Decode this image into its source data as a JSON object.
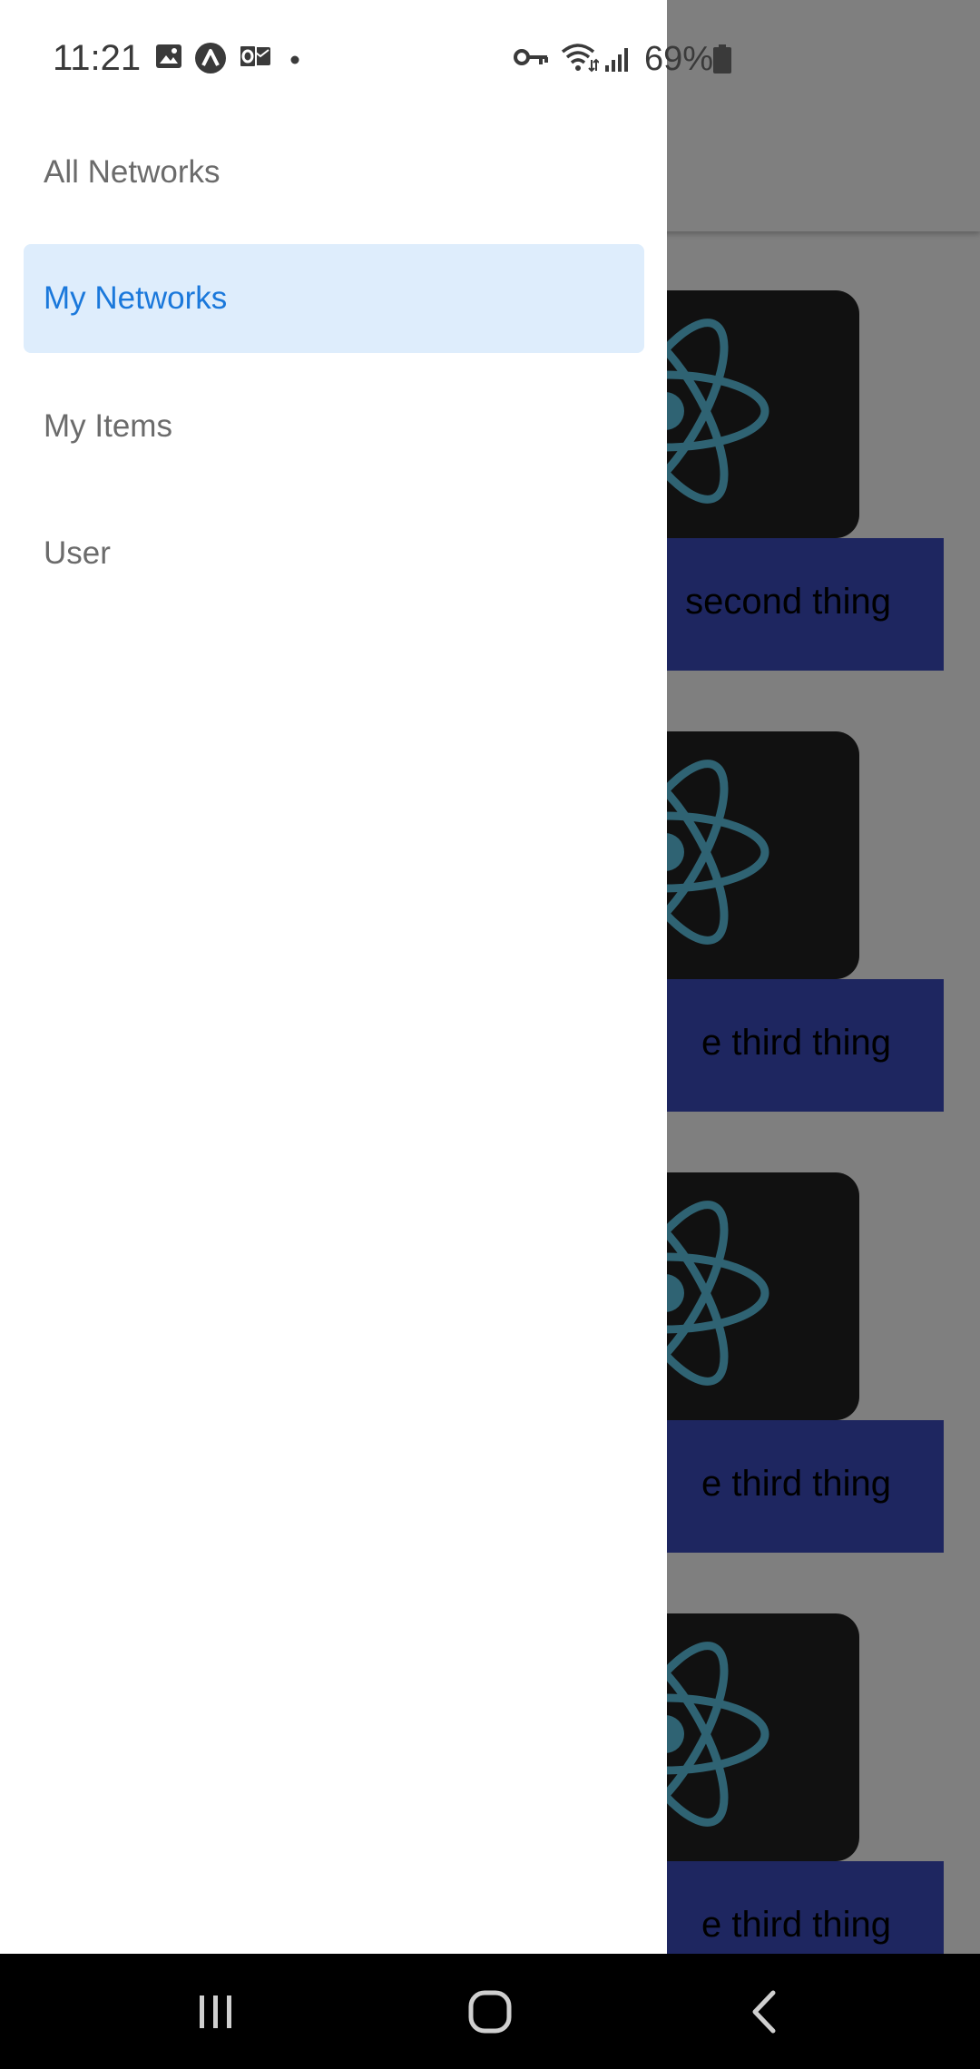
{
  "status_bar": {
    "time": "11:21",
    "battery": "69%",
    "icons": [
      "image-icon",
      "app-a-icon",
      "outlook-icon",
      "dot-icon",
      "vpn-key-icon",
      "wifi-icon",
      "signal-icon",
      "battery-icon"
    ]
  },
  "drawer": {
    "items": [
      {
        "label": "All Networks",
        "active": false
      },
      {
        "label": "My Networks",
        "active": true
      },
      {
        "label": "My Items",
        "active": false
      },
      {
        "label": "User",
        "active": false
      }
    ]
  },
  "content": {
    "cards": [
      {
        "label": "second thing",
        "icon": "react-logo-icon"
      },
      {
        "label": "e third thing",
        "icon": "react-logo-icon"
      },
      {
        "label": "e third thing",
        "icon": "react-logo-icon"
      },
      {
        "label": "e third thing",
        "icon": "react-logo-icon"
      }
    ]
  },
  "nav_bar": {
    "buttons": [
      "recents-icon",
      "home-icon",
      "back-icon"
    ]
  },
  "colors": {
    "active_item_bg": "#deedfc",
    "active_item_text": "#1a78db",
    "inactive_item_text": "#6b6b6b",
    "card_label_bg": "#3c4dc0",
    "react_logo": "#5fc7e6"
  }
}
